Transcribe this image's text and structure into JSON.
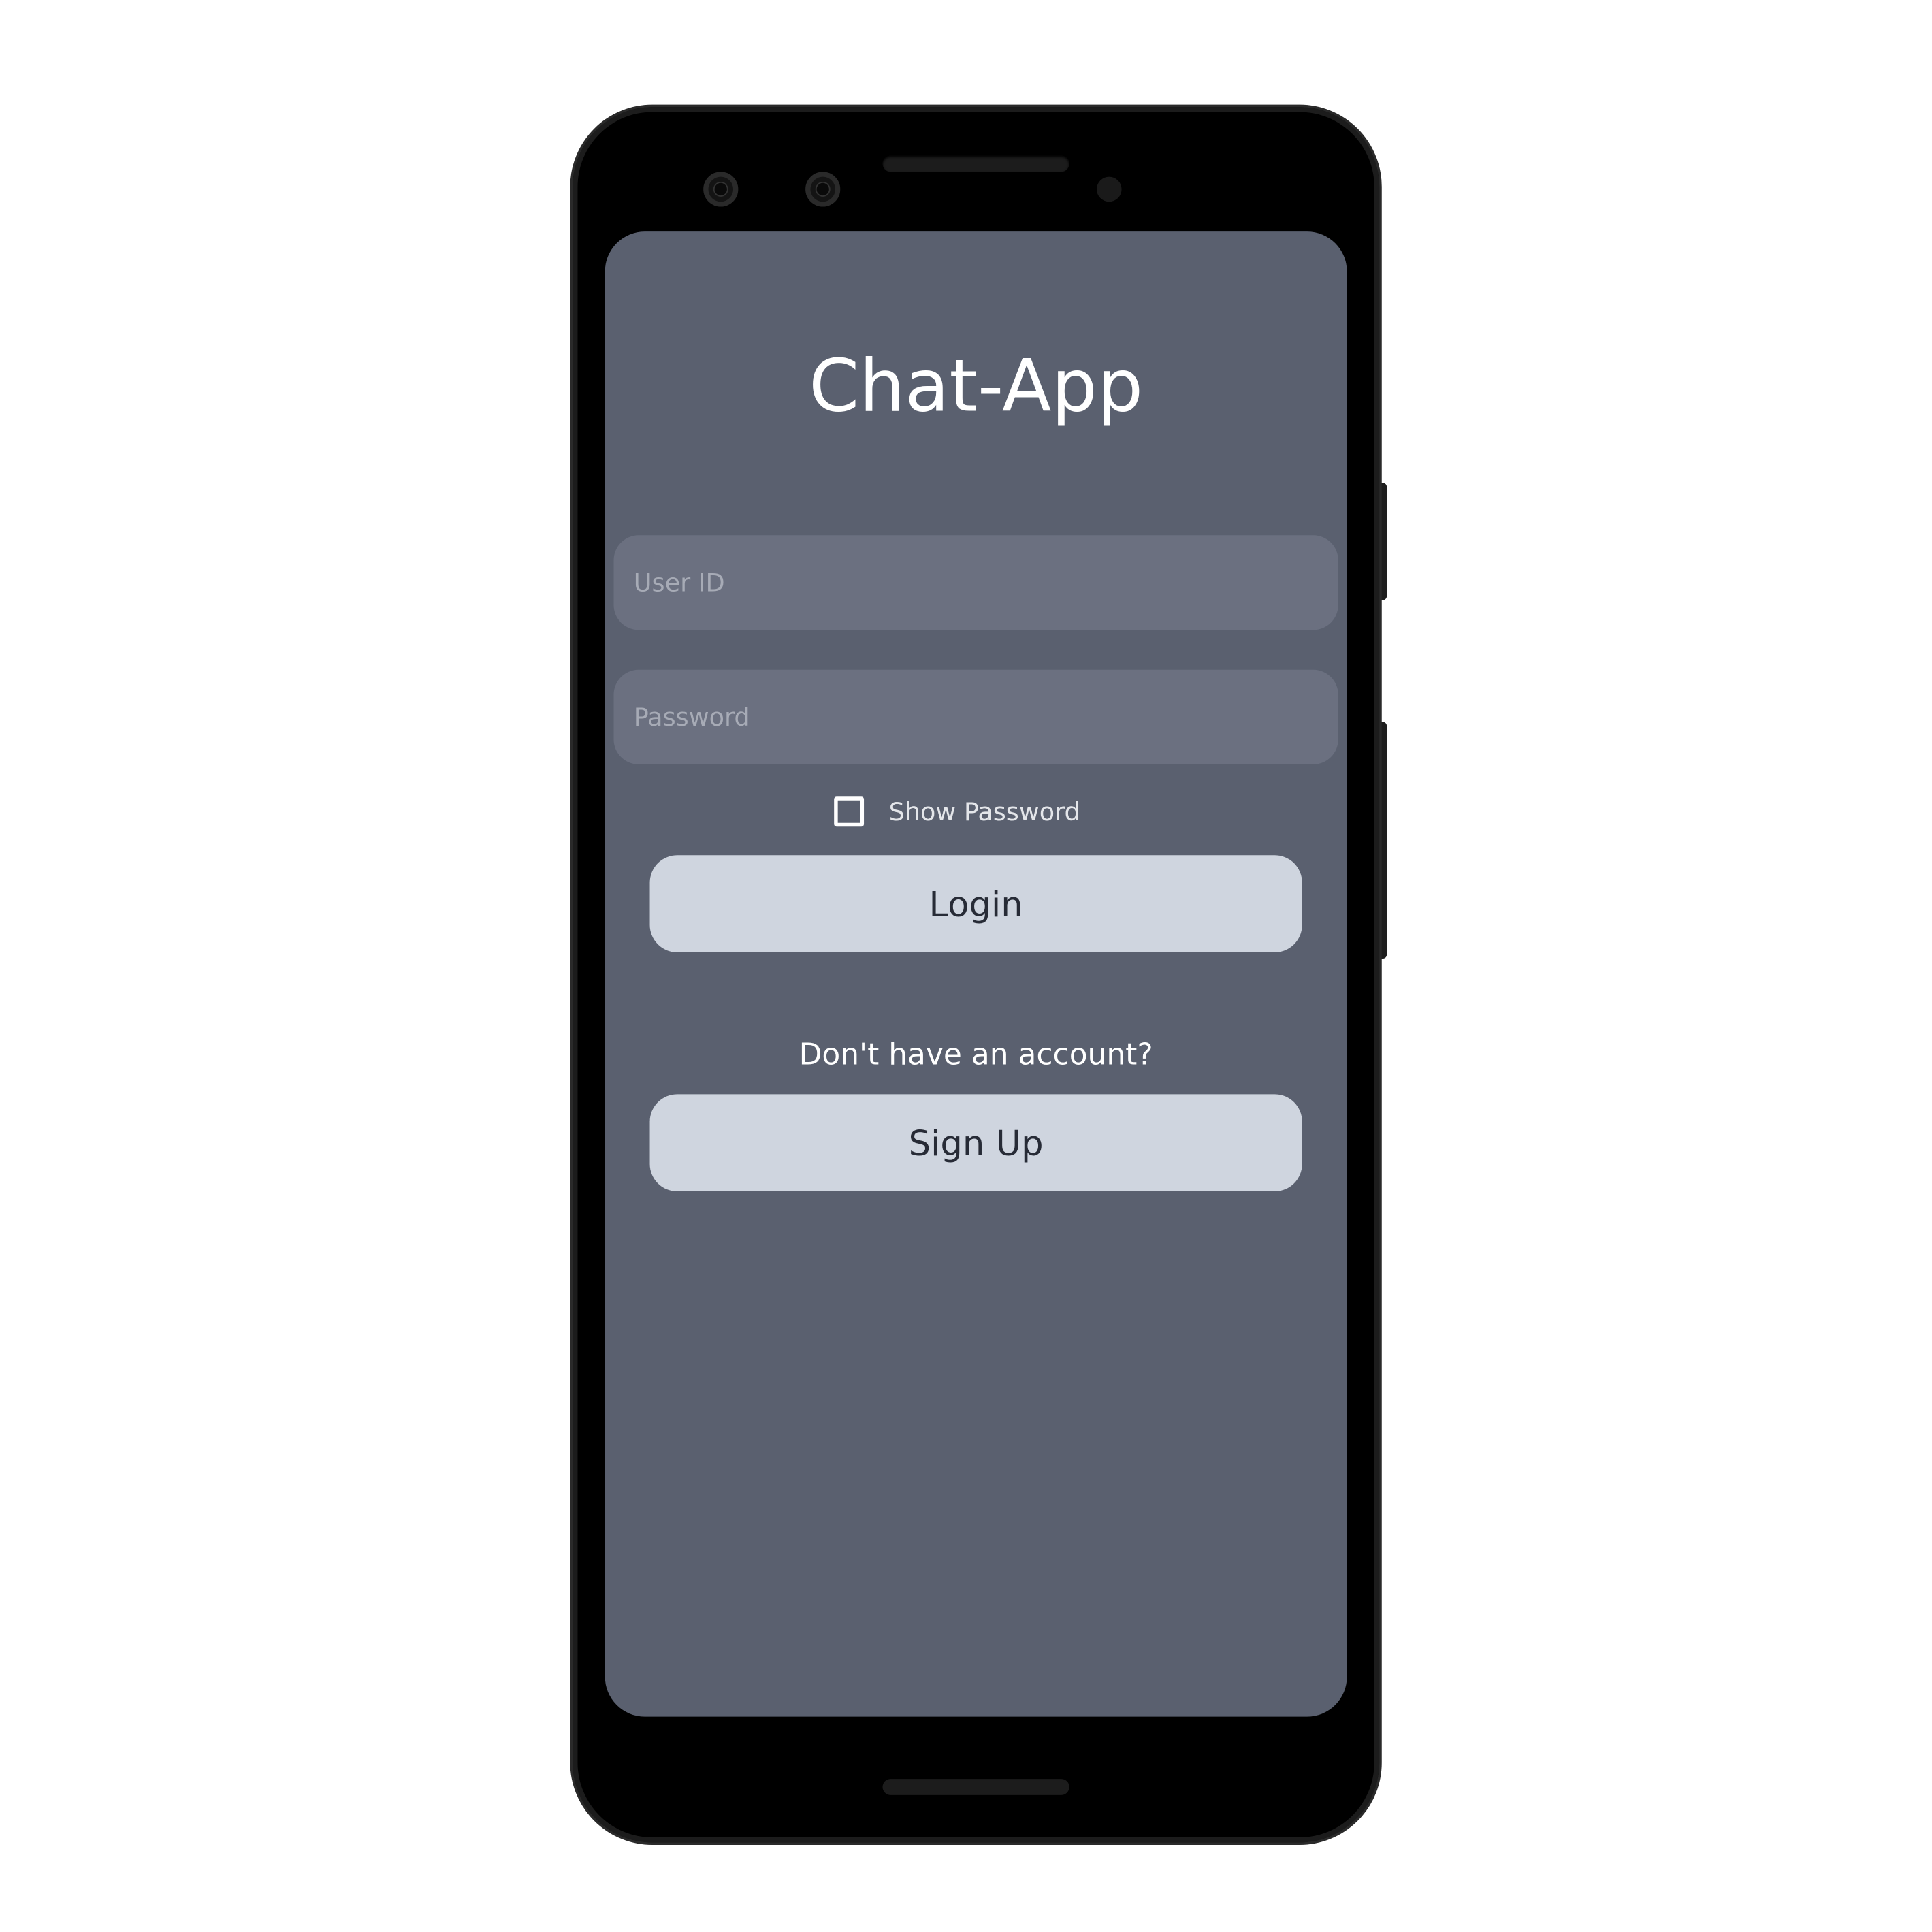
{
  "app": {
    "title": "Chat-App"
  },
  "login_form": {
    "user_id": {
      "value": "",
      "placeholder": "User ID"
    },
    "password": {
      "value": "",
      "placeholder": "Password"
    },
    "show_password": {
      "label": "Show Password",
      "checked": false
    },
    "login_label": "Login",
    "signup_prompt": "Don't have an account?",
    "signup_label": "Sign Up"
  },
  "colors": {
    "screen_background": "#5a606f",
    "input_background": "#6b7080",
    "button_background": "#cfd5df",
    "button_text": "#272b36",
    "device_frame": "#000000"
  },
  "icons": {
    "front_camera": "camera-icon",
    "checkbox": "checkbox-unchecked-icon"
  }
}
